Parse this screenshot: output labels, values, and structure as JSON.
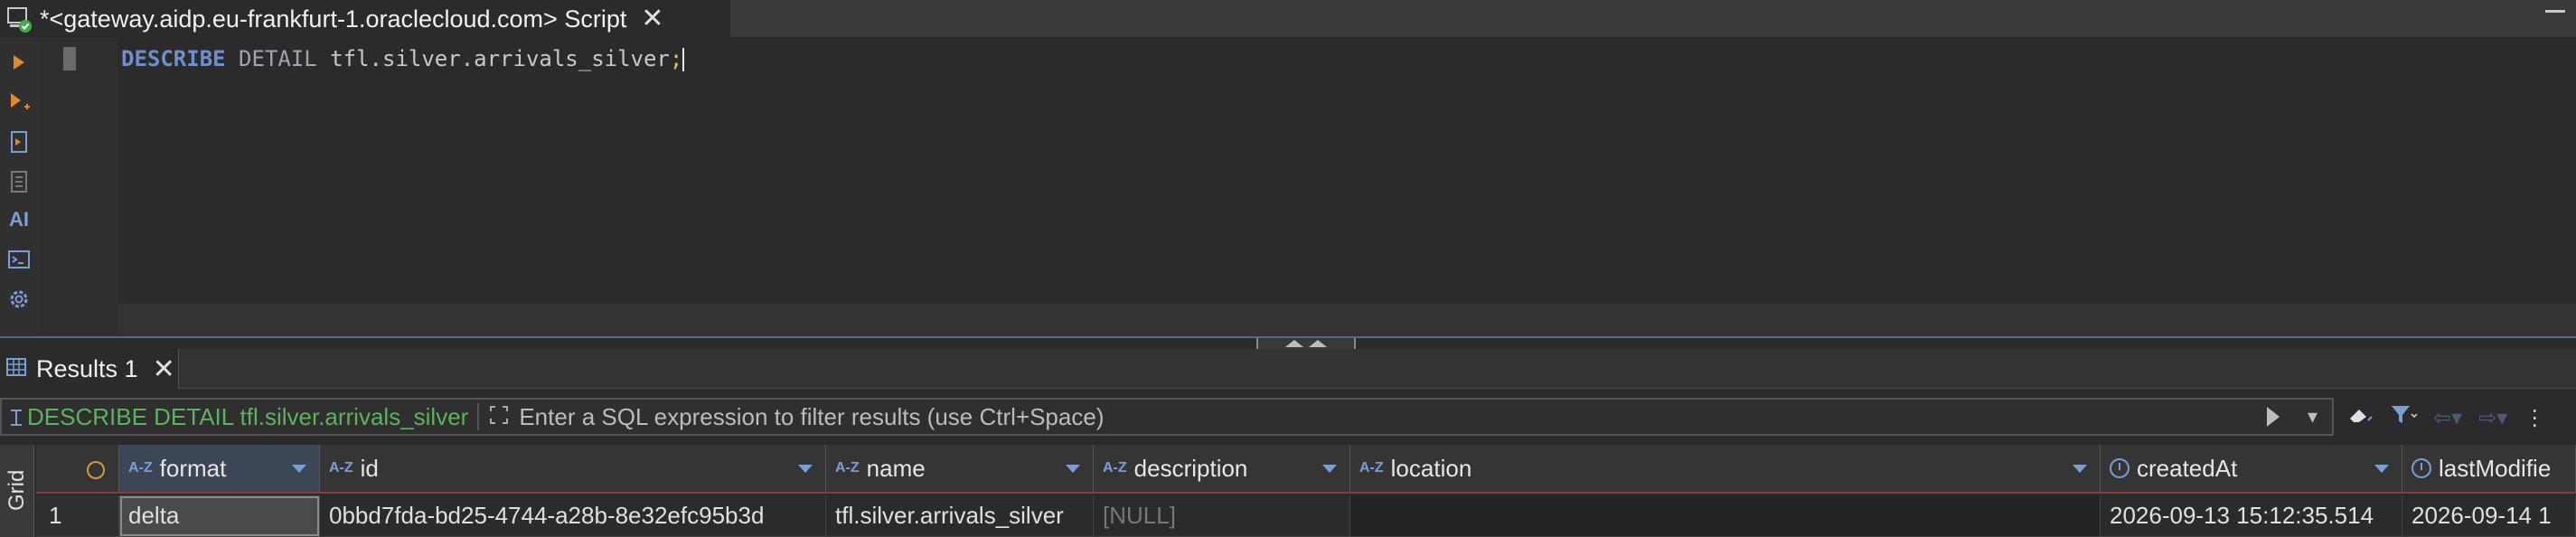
{
  "editor_tab": {
    "title": "*<gateway.aidp.eu-frankfurt-1.oraclecloud.com> Script",
    "close": "✕"
  },
  "editor": {
    "keyword1": "DESCRIBE",
    "keyword2": "DETAIL",
    "identifier": "tfl.silver.arrivals_silver",
    "terminator": ";"
  },
  "left_toolbar": {
    "ai_label": "AI"
  },
  "results_tab": {
    "title": "Results 1",
    "close": "✕"
  },
  "filter": {
    "query_label": "DESCRIBE DETAIL tfl.silver.arrivals_silver",
    "placeholder": "Enter a SQL expression to filter results (use Ctrl+Space)"
  },
  "grid": {
    "side_label": "Grid",
    "columns": [
      "format",
      "id",
      "name",
      "description",
      "location",
      "createdAt",
      "lastModifie"
    ],
    "rows": [
      {
        "num": "1",
        "format": "delta",
        "id": "0bbd7fda-bd25-4744-a28b-8e32efc95b3d",
        "name": "tfl.silver.arrivals_silver",
        "description": "[NULL]",
        "location": "",
        "createdAt": "2026-09-13 15:12:35.514",
        "lastModified": "2026-09-14 1"
      }
    ]
  },
  "colors": {
    "background": "#2b2b2b",
    "keyword": "#6f8fc8",
    "query_label": "#5bb35b",
    "header_accent": "#8a3a3a"
  }
}
